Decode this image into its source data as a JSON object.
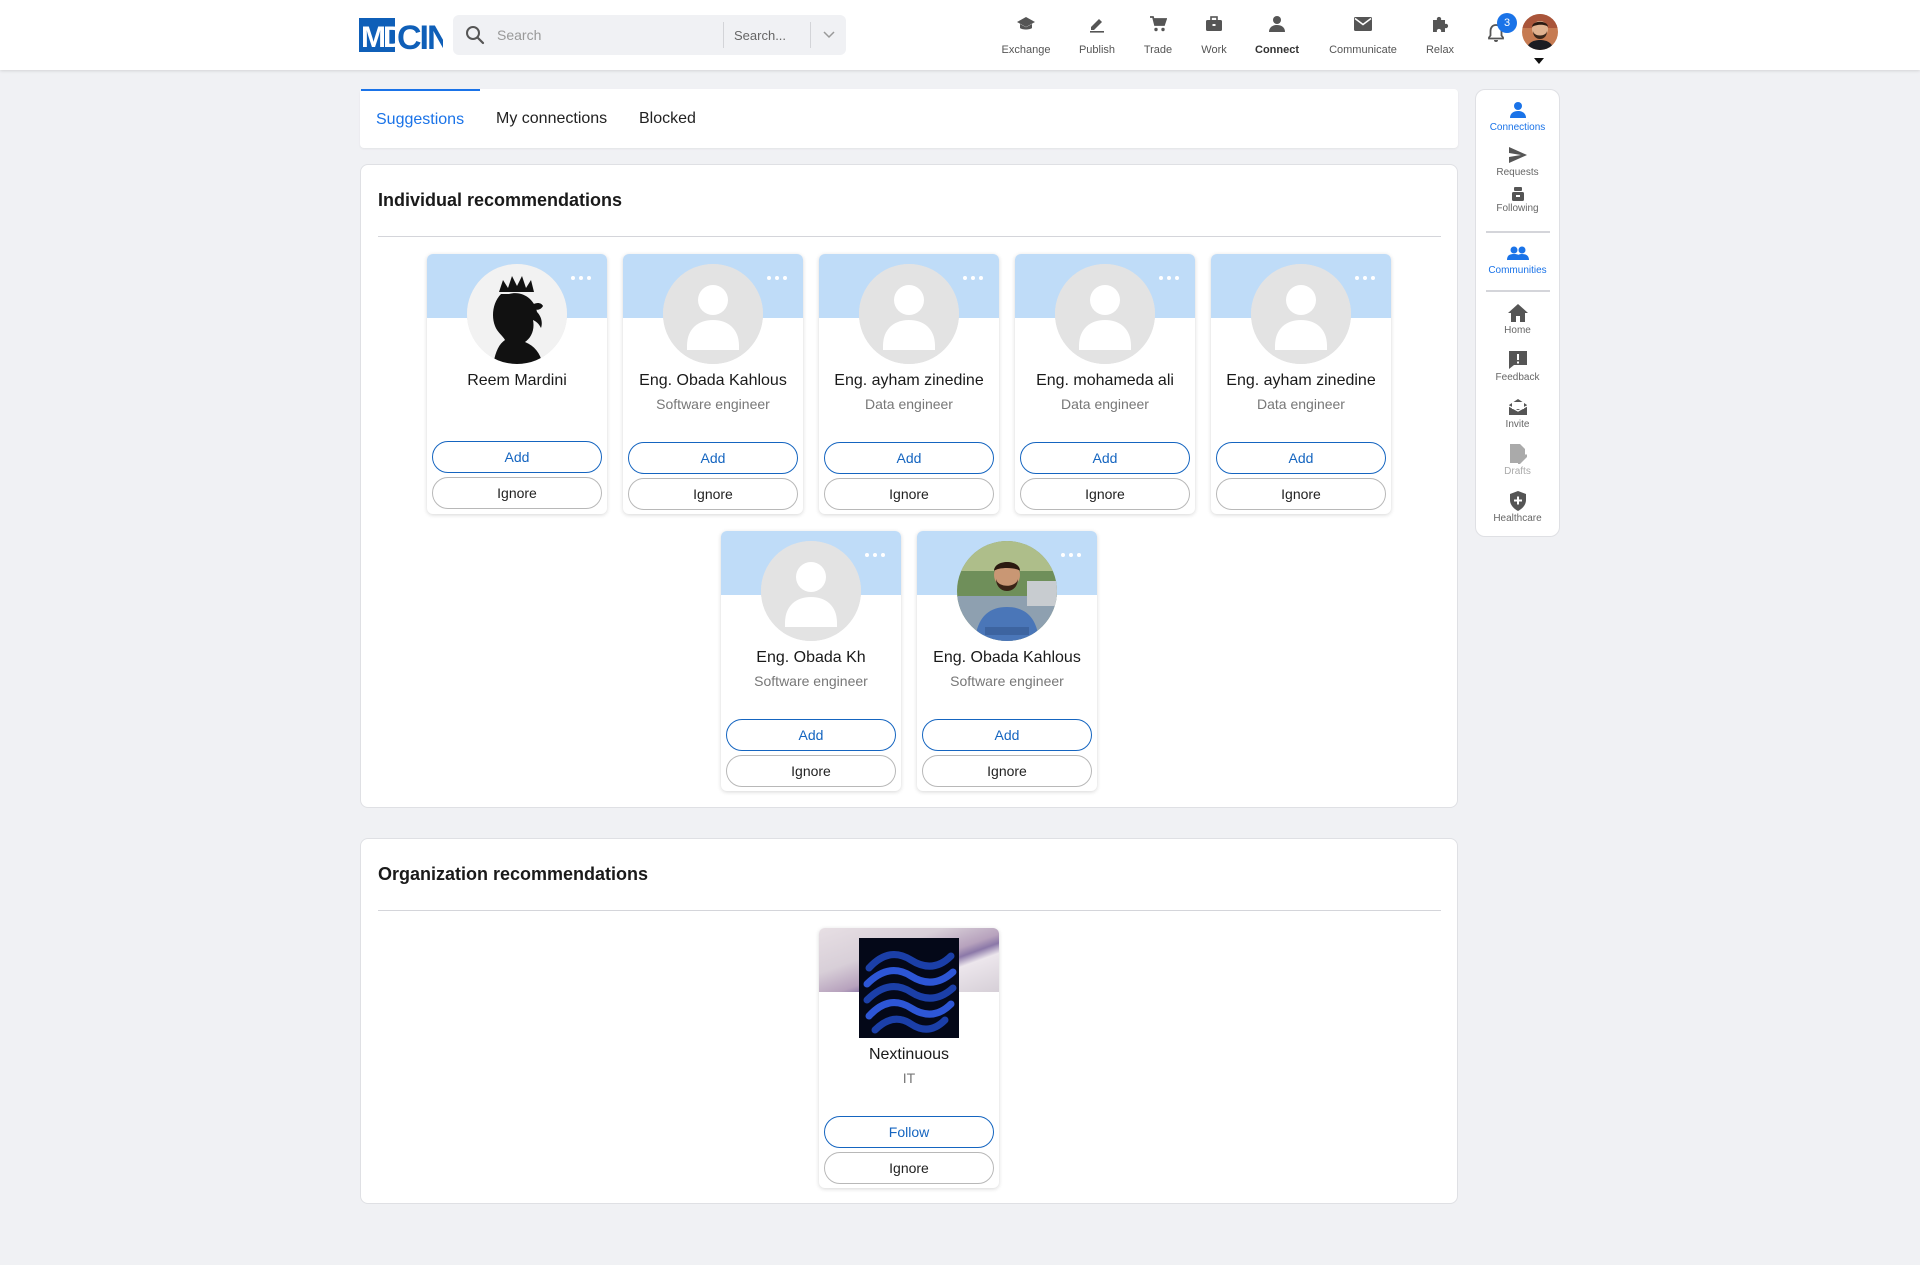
{
  "header": {
    "logo_text": "MDCIN",
    "search": {
      "placeholder": "Search",
      "select_placeholder": "Search..."
    },
    "nav": [
      {
        "label": "Exchange",
        "icon": "graduation-cap-icon"
      },
      {
        "label": "Publish",
        "icon": "pencil-icon"
      },
      {
        "label": "Trade",
        "icon": "cart-icon"
      },
      {
        "label": "Work",
        "icon": "briefcase-icon"
      },
      {
        "label": "Connect",
        "icon": "person-icon",
        "active": true
      },
      {
        "label": "Communicate",
        "icon": "envelope-icon"
      },
      {
        "label": "Relax",
        "icon": "puzzle-icon"
      }
    ],
    "notifications_count": "3"
  },
  "tabs": [
    {
      "label": "Suggestions",
      "active": true
    },
    {
      "label": "My connections"
    },
    {
      "label": "Blocked"
    }
  ],
  "sidebar": [
    {
      "label": "Connections",
      "icon": "person-icon",
      "state": "blue"
    },
    {
      "label": "Requests",
      "icon": "send-icon",
      "state": "normal"
    },
    {
      "label": "Following",
      "icon": "following-icon",
      "state": "normal"
    },
    {
      "label": "Communities",
      "icon": "people-icon",
      "state": "blue"
    },
    {
      "label": "Home",
      "icon": "home-icon",
      "state": "normal"
    },
    {
      "label": "Feedback",
      "icon": "feedback-icon",
      "state": "normal"
    },
    {
      "label": "Invite",
      "icon": "invite-icon",
      "state": "normal"
    },
    {
      "label": "Drafts",
      "icon": "drafts-icon",
      "state": "disabled"
    },
    {
      "label": "Healthcare",
      "icon": "shield-icon",
      "state": "normal"
    }
  ],
  "individual": {
    "title": "Individual recommendations",
    "people": [
      {
        "name": "Reem Mardini",
        "role": "",
        "avatar": "silhouette-photo"
      },
      {
        "name": "Eng. Obada Kahlous",
        "role": "Software engineer",
        "avatar": "placeholder"
      },
      {
        "name": "Eng. ayham zinedine",
        "role": "Data engineer",
        "avatar": "placeholder"
      },
      {
        "name": "Eng. mohameda ali",
        "role": "Data engineer",
        "avatar": "placeholder"
      },
      {
        "name": "Eng. ayham zinedine",
        "role": "Data engineer",
        "avatar": "placeholder"
      },
      {
        "name": "Eng. Obada Kh",
        "role": "Software engineer",
        "avatar": "placeholder"
      },
      {
        "name": "Eng. Obada Kahlous",
        "role": "Software engineer",
        "avatar": "man-photo"
      }
    ],
    "add_label": "Add",
    "ignore_label": "Ignore"
  },
  "organization": {
    "title": "Organization recommendations",
    "orgs": [
      {
        "name": "Nextinuous",
        "category": "IT"
      }
    ],
    "follow_label": "Follow",
    "ignore_label": "Ignore"
  },
  "colors": {
    "accent": "#1a73e8",
    "button_blue": "#1565c0",
    "cover": "#bfdcf8",
    "page_bg": "#f0f1f4"
  }
}
